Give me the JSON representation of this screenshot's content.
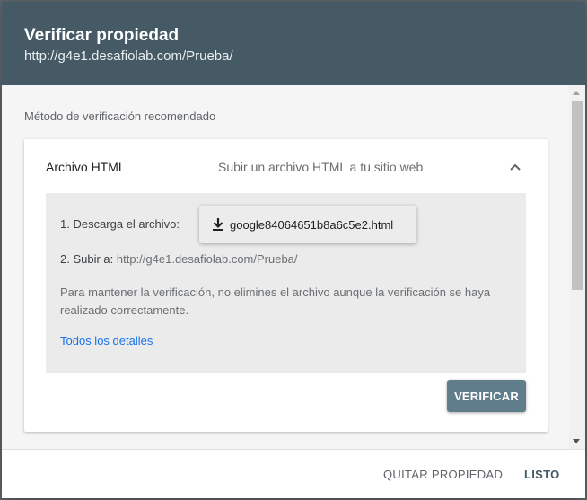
{
  "dialog": {
    "title": "Verificar propiedad",
    "subtitle": "http://g4e1.desafiolab.com/Prueba/"
  },
  "content": {
    "section_label": "Método de verificación recomendado",
    "card": {
      "title": "Archivo HTML",
      "description": "Subir un archivo HTML a tu sitio web",
      "collapse_icon": "chevron-up-icon",
      "step1_label": "1. Descarga el archivo:",
      "download_icon": "download-icon",
      "download_file": "google84064651b8a6c5e2.html",
      "step2_label": "2. Subir a:",
      "step2_url": "http://g4e1.desafiolab.com/Prueba/",
      "note": "Para mantener la verificación, no elimines el archivo aunque la verificación se haya realizado correctamente.",
      "details_link": "Todos los detalles",
      "verify_button": "VERIFICAR"
    }
  },
  "footer": {
    "remove_button": "QUITAR PROPIEDAD",
    "done_button": "LISTO"
  },
  "colors": {
    "header_bg": "#455a64",
    "verify_bg": "#607d8b",
    "link": "#1a73e8"
  }
}
